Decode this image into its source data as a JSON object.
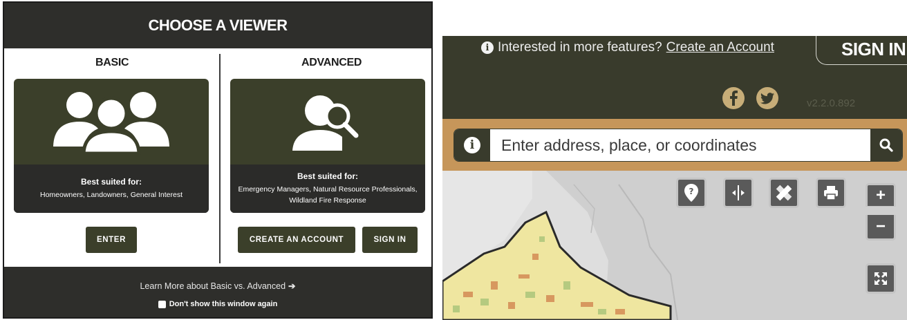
{
  "chooser": {
    "title": "CHOOSE A VIEWER",
    "basic": {
      "title": "BASIC",
      "best_suited_label": "Best suited for:",
      "best_suited_value": "Homeowners, Landowners, General Interest",
      "enter_button": "ENTER",
      "icon": "users-group-icon"
    },
    "advanced": {
      "title": "ADVANCED",
      "best_suited_label": "Best suited for:",
      "best_suited_value_line1": "Emergency Managers, Natural Resource Professionals,",
      "best_suited_value_line2": "Wildland Fire Response",
      "create_account_button": "CREATE AN ACCOUNT",
      "sign_in_button": "SIGN IN",
      "icon": "user-search-icon"
    },
    "learn_more": "Learn More about Basic vs. Advanced",
    "dont_show": "Don't show this window again"
  },
  "viewer": {
    "notice_text": "Interested in more features?",
    "create_account_link": "Create an Account",
    "sign_in": "SIGN IN",
    "version": "v2.2.0.892",
    "search_placeholder": "Enter address, place, or coordinates",
    "social": [
      "facebook-icon",
      "twitter-icon"
    ],
    "tools": [
      "help-icon",
      "swipe-compare-icon",
      "measure-icon",
      "print-icon",
      "zoom-in-icon",
      "zoom-out-icon",
      "fullscreen-icon"
    ]
  },
  "colors": {
    "dark_olive": "#3b3f2a",
    "charcoal": "#2e2e2b",
    "tan": "#c6965a",
    "social_gold": "#c7ad78"
  }
}
